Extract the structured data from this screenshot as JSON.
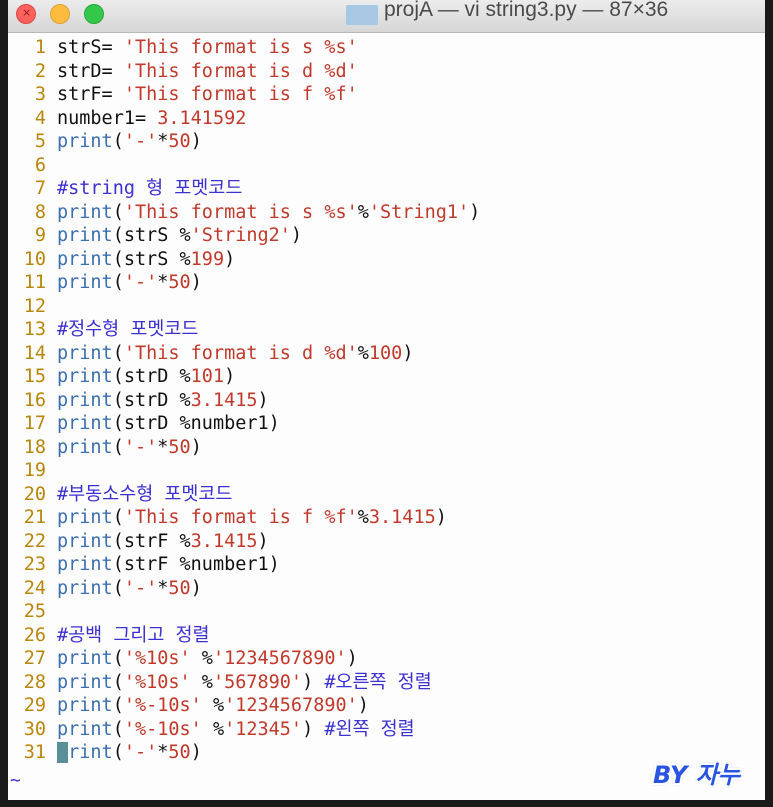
{
  "window": {
    "title": "projA — vi string3.py — 87×36"
  },
  "editor": {
    "lines": [
      {
        "n": "1",
        "tokens": [
          [
            "plain",
            "strS= "
          ],
          [
            "str",
            "'This format is s %s'"
          ]
        ]
      },
      {
        "n": "2",
        "tokens": [
          [
            "plain",
            "strD= "
          ],
          [
            "str",
            "'This format is d %d'"
          ]
        ]
      },
      {
        "n": "3",
        "tokens": [
          [
            "plain",
            "strF= "
          ],
          [
            "str",
            "'This format is f %f'"
          ]
        ]
      },
      {
        "n": "4",
        "tokens": [
          [
            "plain",
            "number1= "
          ],
          [
            "num",
            "3.141592"
          ]
        ]
      },
      {
        "n": "5",
        "tokens": [
          [
            "fn",
            "print"
          ],
          [
            "plain",
            "("
          ],
          [
            "str",
            "'-'"
          ],
          [
            "plain",
            "*"
          ],
          [
            "num",
            "50"
          ],
          [
            "plain",
            ")"
          ]
        ]
      },
      {
        "n": "6",
        "tokens": []
      },
      {
        "n": "7",
        "tokens": [
          [
            "cmt",
            "#string 형 포멧코드"
          ]
        ]
      },
      {
        "n": "8",
        "tokens": [
          [
            "fn",
            "print"
          ],
          [
            "plain",
            "("
          ],
          [
            "str",
            "'This format is s %s'"
          ],
          [
            "plain",
            "%"
          ],
          [
            "str",
            "'String1'"
          ],
          [
            "plain",
            ")"
          ]
        ]
      },
      {
        "n": "9",
        "tokens": [
          [
            "fn",
            "print"
          ],
          [
            "plain",
            "(strS %"
          ],
          [
            "str",
            "'String2'"
          ],
          [
            "plain",
            ")"
          ]
        ]
      },
      {
        "n": "10",
        "tokens": [
          [
            "fn",
            "print"
          ],
          [
            "plain",
            "(strS %"
          ],
          [
            "num",
            "199"
          ],
          [
            "plain",
            ")"
          ]
        ]
      },
      {
        "n": "11",
        "tokens": [
          [
            "fn",
            "print"
          ],
          [
            "plain",
            "("
          ],
          [
            "str",
            "'-'"
          ],
          [
            "plain",
            "*"
          ],
          [
            "num",
            "50"
          ],
          [
            "plain",
            ")"
          ]
        ]
      },
      {
        "n": "12",
        "tokens": []
      },
      {
        "n": "13",
        "tokens": [
          [
            "cmt",
            "#정수형 포멧코드"
          ]
        ]
      },
      {
        "n": "14",
        "tokens": [
          [
            "fn",
            "print"
          ],
          [
            "plain",
            "("
          ],
          [
            "str",
            "'This format is d %d'"
          ],
          [
            "plain",
            "%"
          ],
          [
            "num",
            "100"
          ],
          [
            "plain",
            ")"
          ]
        ]
      },
      {
        "n": "15",
        "tokens": [
          [
            "fn",
            "print"
          ],
          [
            "plain",
            "(strD %"
          ],
          [
            "num",
            "101"
          ],
          [
            "plain",
            ")"
          ]
        ]
      },
      {
        "n": "16",
        "tokens": [
          [
            "fn",
            "print"
          ],
          [
            "plain",
            "(strD %"
          ],
          [
            "num",
            "3.1415"
          ],
          [
            "plain",
            ")"
          ]
        ]
      },
      {
        "n": "17",
        "tokens": [
          [
            "fn",
            "print"
          ],
          [
            "plain",
            "(strD %number1)"
          ]
        ]
      },
      {
        "n": "18",
        "tokens": [
          [
            "fn",
            "print"
          ],
          [
            "plain",
            "("
          ],
          [
            "str",
            "'-'"
          ],
          [
            "plain",
            "*"
          ],
          [
            "num",
            "50"
          ],
          [
            "plain",
            ")"
          ]
        ]
      },
      {
        "n": "19",
        "tokens": []
      },
      {
        "n": "20",
        "tokens": [
          [
            "cmt",
            "#부동소수형 포멧코드"
          ]
        ]
      },
      {
        "n": "21",
        "tokens": [
          [
            "fn",
            "print"
          ],
          [
            "plain",
            "("
          ],
          [
            "str",
            "'This format is f %f'"
          ],
          [
            "plain",
            "%"
          ],
          [
            "num",
            "3.1415"
          ],
          [
            "plain",
            ")"
          ]
        ]
      },
      {
        "n": "22",
        "tokens": [
          [
            "fn",
            "print"
          ],
          [
            "plain",
            "(strF %"
          ],
          [
            "num",
            "3.1415"
          ],
          [
            "plain",
            ")"
          ]
        ]
      },
      {
        "n": "23",
        "tokens": [
          [
            "fn",
            "print"
          ],
          [
            "plain",
            "(strF %number1)"
          ]
        ]
      },
      {
        "n": "24",
        "tokens": [
          [
            "fn",
            "print"
          ],
          [
            "plain",
            "("
          ],
          [
            "str",
            "'-'"
          ],
          [
            "plain",
            "*"
          ],
          [
            "num",
            "50"
          ],
          [
            "plain",
            ")"
          ]
        ]
      },
      {
        "n": "25",
        "tokens": []
      },
      {
        "n": "26",
        "tokens": [
          [
            "cmt",
            "#공백 그리고 정렬"
          ]
        ]
      },
      {
        "n": "27",
        "tokens": [
          [
            "fn",
            "print"
          ],
          [
            "plain",
            "("
          ],
          [
            "str",
            "'%10s'"
          ],
          [
            "plain",
            " %"
          ],
          [
            "str",
            "'1234567890'"
          ],
          [
            "plain",
            ")"
          ]
        ]
      },
      {
        "n": "28",
        "tokens": [
          [
            "fn",
            "print"
          ],
          [
            "plain",
            "("
          ],
          [
            "str",
            "'%10s'"
          ],
          [
            "plain",
            " %"
          ],
          [
            "str",
            "'567890'"
          ],
          [
            "plain",
            ") "
          ],
          [
            "cmt",
            "#오른쪽 정렬"
          ]
        ]
      },
      {
        "n": "29",
        "tokens": [
          [
            "fn",
            "print"
          ],
          [
            "plain",
            "("
          ],
          [
            "str",
            "'%-10s'"
          ],
          [
            "plain",
            " %"
          ],
          [
            "str",
            "'1234567890'"
          ],
          [
            "plain",
            ")"
          ]
        ]
      },
      {
        "n": "30",
        "tokens": [
          [
            "fn",
            "print"
          ],
          [
            "plain",
            "("
          ],
          [
            "str",
            "'%-10s'"
          ],
          [
            "plain",
            " %"
          ],
          [
            "str",
            "'12345'"
          ],
          [
            "plain",
            ") "
          ],
          [
            "cmt",
            "#왼쪽 정렬"
          ]
        ]
      },
      {
        "n": "31",
        "tokens": [
          [
            "cursor",
            "p"
          ],
          [
            "fn",
            "rint"
          ],
          [
            "plain",
            "("
          ],
          [
            "str",
            "'-'"
          ],
          [
            "plain",
            "*"
          ],
          [
            "num",
            "50"
          ],
          [
            "plain",
            ")"
          ]
        ]
      }
    ],
    "empty_marker": "~"
  },
  "watermark": "BY 자누",
  "colors": {
    "function": "#3b6fb0",
    "string": "#c0392b",
    "comment": "#3b30d0",
    "line_number": "#b8860b",
    "cursor": "#5a8f99"
  }
}
